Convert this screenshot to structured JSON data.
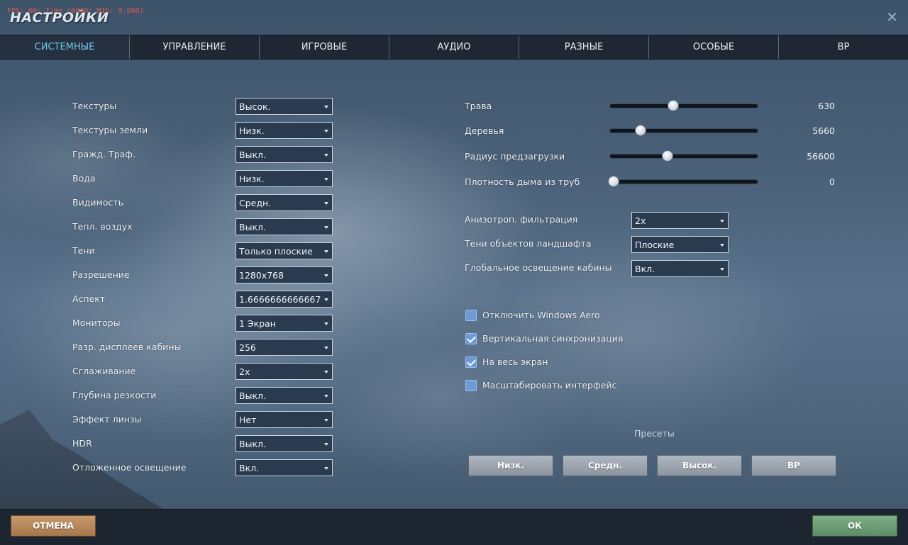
{
  "debug": {
    "fps_text": "FPS: 60; Time (0000; MIS: 0.000)"
  },
  "window": {
    "title": "НАСТРОЙКИ",
    "close_icon": "close-icon"
  },
  "tabs": [
    {
      "label": "СИСТЕМНЫЕ",
      "active": true
    },
    {
      "label": "УПРАВЛЕНИЕ",
      "active": false
    },
    {
      "label": "ИГРОВЫЕ",
      "active": false
    },
    {
      "label": "АУДИО",
      "active": false
    },
    {
      "label": "РАЗНЫЕ",
      "active": false
    },
    {
      "label": "ОСОБЫЕ",
      "active": false
    },
    {
      "label": "ВР",
      "active": false
    }
  ],
  "left_settings": [
    {
      "label": "Текстуры",
      "value": "Высок."
    },
    {
      "label": "Текстуры земли",
      "value": "Низк."
    },
    {
      "label": "Гражд. Траф.",
      "value": "Выкл."
    },
    {
      "label": "Вода",
      "value": "Низк."
    },
    {
      "label": "Видимость",
      "value": "Средн."
    },
    {
      "label": "Тепл. воздух",
      "value": "Выкл."
    },
    {
      "label": "Тени",
      "value": "Только плоские"
    },
    {
      "label": "Разрешение",
      "value": "1280x768"
    },
    {
      "label": "Аспект",
      "value": "1.6666666666667"
    },
    {
      "label": "Мониторы",
      "value": "1 Экран"
    },
    {
      "label": "Разр. дисплеев кабины",
      "value": "256"
    },
    {
      "label": "Сглаживание",
      "value": "2x"
    },
    {
      "label": "Глубина резкости",
      "value": "Выкл."
    },
    {
      "label": "Эффект линзы",
      "value": "Нет"
    },
    {
      "label": "HDR",
      "value": "Выкл."
    },
    {
      "label": "Отложенное освещение",
      "value": "Вкл."
    }
  ],
  "sliders": [
    {
      "label": "Трава",
      "value": "630",
      "level": 0.42
    },
    {
      "label": "Деревья",
      "value": "5660",
      "level": 0.19
    },
    {
      "label": "Радиус предзагрузки",
      "value": "56600",
      "level": 0.38
    },
    {
      "label": "Плотность дыма из труб",
      "value": "0",
      "level": 0.0
    }
  ],
  "right_settings": [
    {
      "label": "Анизотроп. фильтрация",
      "value": "2x"
    },
    {
      "label": "Тени объектов ландшафта",
      "value": "Плоские"
    },
    {
      "label": "Глобальное освещение кабины",
      "value": "Вкл."
    }
  ],
  "checkboxes": [
    {
      "label": "Отключить Windows Aero",
      "checked": false
    },
    {
      "label": "Вертикальная синхронизация",
      "checked": true
    },
    {
      "label": "На весь экран",
      "checked": true
    },
    {
      "label": "Масштабировать интерфейс",
      "checked": false
    }
  ],
  "presets": {
    "label": "Пресеты",
    "buttons": [
      "Низк.",
      "Средн.",
      "Высок.",
      "ВР"
    ]
  },
  "footer": {
    "cancel_label": "ОТМЕНА",
    "ok_label": "ОК"
  },
  "colors": {
    "active_tab": "#6fc8e8",
    "checkbox": "#6e9bd8",
    "cancel_button": "#b5865a",
    "ok_button": "#6f9f77"
  }
}
